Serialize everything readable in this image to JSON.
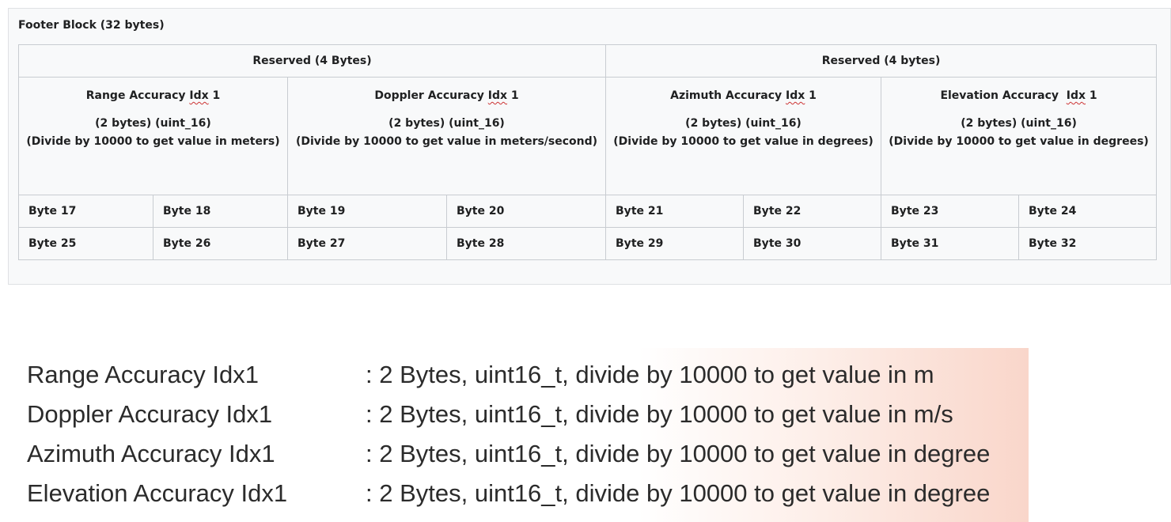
{
  "footer_block": {
    "title": "Footer Block (32 bytes)",
    "reserved": [
      "Reserved (4 Bytes)",
      "Reserved (4 bytes)"
    ],
    "fields": [
      {
        "name_prefix": "Range Accuracy ",
        "name_idx": "Idx",
        "name_suffix": " 1",
        "size": "(2 bytes) (uint_16)",
        "note": "(Divide by 10000 to get value in meters)"
      },
      {
        "name_prefix": "Doppler Accuracy ",
        "name_idx": "Idx",
        "name_suffix": " 1",
        "size": "(2 bytes) (uint_16)",
        "note": "(Divide by 10000 to get value in meters/second)"
      },
      {
        "name_prefix": "Azimuth Accuracy ",
        "name_idx": "Idx",
        "name_suffix": " 1",
        "size": "(2 bytes) (uint_16)",
        "note": "(Divide by 10000 to get value in degrees)"
      },
      {
        "name_prefix": "Elevation Accuracy  ",
        "name_idx": "Idx",
        "name_suffix": " 1",
        "size": "(2 bytes) (uint_16)",
        "note": "(Divide by 10000 to get value in degrees)"
      }
    ],
    "byte_rows": [
      [
        "Byte 17",
        "Byte 18",
        "Byte 19",
        "Byte 20",
        "Byte 21",
        "Byte 22",
        "Byte 23",
        "Byte 24"
      ],
      [
        "Byte 25",
        "Byte 26",
        "Byte 27",
        "Byte 28",
        "Byte 29",
        "Byte 30",
        "Byte 31",
        "Byte 32"
      ]
    ]
  },
  "descriptions": [
    {
      "name": "Range Accuracy Idx1",
      "value": ": 2 Bytes, uint16_t, divide by 10000 to get value in m"
    },
    {
      "name": "Doppler Accuracy Idx1",
      "value": ": 2 Bytes, uint16_t, divide by 10000 to get value in m/s"
    },
    {
      "name": "Azimuth Accuracy Idx1",
      "value": ": 2 Bytes, uint16_t, divide by 10000 to get value in degree"
    },
    {
      "name": "Elevation Accuracy Idx1",
      "value": ": 2 Bytes, uint16_t, divide by 10000 to get value in degree"
    }
  ],
  "colors": {
    "panel_background": "#f8f9fa",
    "table_border": "#c8ccd1",
    "text": "#202122",
    "spell_underline": "#cc3333",
    "gradient_accent": "#f9d6ca"
  }
}
